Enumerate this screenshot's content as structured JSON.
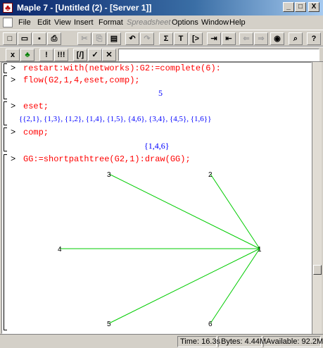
{
  "window": {
    "title": "Maple 7  - [Untitled (2) - [Server 1]]",
    "app_icon": "maple-leaf-icon",
    "controls": [
      "_",
      "□",
      "X"
    ]
  },
  "menu": {
    "items": [
      "File",
      "Edit",
      "View",
      "Insert",
      "Format",
      "Spreadsheet",
      "Options",
      "Window",
      "Help"
    ],
    "disabled": [
      "Spreadsheet"
    ]
  },
  "toolbar1": {
    "buttons": [
      {
        "name": "new-icon",
        "glyph": "□"
      },
      {
        "name": "open-icon",
        "glyph": "▭"
      },
      {
        "name": "save-icon",
        "glyph": "▪"
      },
      {
        "name": "print-icon",
        "glyph": "⎙"
      },
      {
        "name": "cut-icon",
        "glyph": "✂"
      },
      {
        "name": "copy-icon",
        "glyph": "⎘"
      },
      {
        "name": "paste-icon",
        "glyph": "▤"
      },
      {
        "name": "undo-icon",
        "glyph": "↶"
      },
      {
        "name": "redo-icon",
        "glyph": "↷"
      },
      {
        "name": "sigma-icon",
        "glyph": "Σ"
      },
      {
        "name": "text-icon",
        "glyph": "T"
      },
      {
        "name": "prompt-icon",
        "glyph": "[>"
      },
      {
        "name": "indent-icon",
        "glyph": "⇥"
      },
      {
        "name": "outdent-icon",
        "glyph": "⇤"
      },
      {
        "name": "back-icon",
        "glyph": "⇐"
      },
      {
        "name": "forward-icon",
        "glyph": "⇒"
      },
      {
        "name": "stop-icon",
        "glyph": "◉"
      },
      {
        "name": "zoom-icon",
        "glyph": "⌕"
      },
      {
        "name": "help-icon",
        "glyph": "?"
      }
    ]
  },
  "toolbar2": {
    "buttons": [
      {
        "name": "math-mode-icon",
        "glyph": "x"
      },
      {
        "name": "maple-leaf-icon",
        "glyph": "♣"
      },
      {
        "name": "execute-icon",
        "glyph": "!"
      },
      {
        "name": "execute-all-icon",
        "glyph": "!!!"
      },
      {
        "name": "format-output-icon",
        "glyph": "[/]"
      },
      {
        "name": "check-icon",
        "glyph": "✓"
      },
      {
        "name": "cancel-icon",
        "glyph": "✕"
      }
    ],
    "input_value": ""
  },
  "worksheet": {
    "prompt_symbol": ">",
    "cmd1": "restart:with(networks):G2:=complete(6):",
    "cmd2": "flow(G2,1,4,eset,comp);",
    "out2": "5",
    "cmd3": "eset;",
    "out3": "{{2,1}, {1,3}, {1,2}, {1,4}, {1,5}, {4,6}, {3,4}, {4,5}, {1,6}}",
    "cmd4": "comp;",
    "out4": "{1,4,6}",
    "cmd5": "GG:=shortpathtree(G2,1):draw(GG);"
  },
  "graph": {
    "nodes": [
      {
        "label": "1"
      },
      {
        "label": "2"
      },
      {
        "label": "3"
      },
      {
        "label": "4"
      },
      {
        "label": "5"
      },
      {
        "label": "6"
      }
    ],
    "edges": [
      [
        1,
        2
      ],
      [
        1,
        3
      ],
      [
        1,
        4
      ],
      [
        1,
        5
      ],
      [
        1,
        6
      ]
    ],
    "edge_color": "#00cc00"
  },
  "status": {
    "time": "Time: 16.3s",
    "bytes": "Bytes: 4.44M",
    "available": "Available: 92.2M"
  }
}
